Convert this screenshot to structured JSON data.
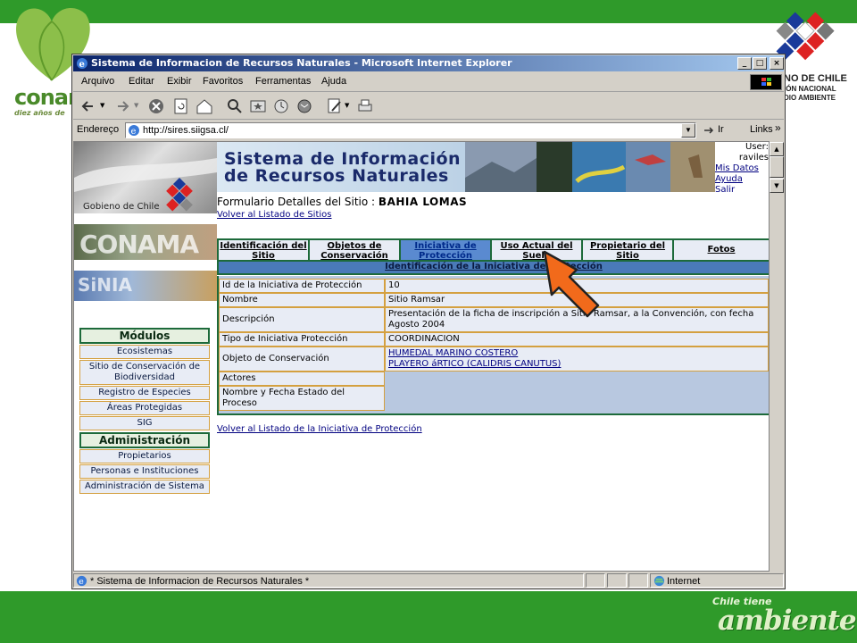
{
  "slide": {
    "logo_left": {
      "word": "conam",
      "sub": "diez años de"
    },
    "logo_right": {
      "line1": "NO DE CHILE",
      "line2": "IÓN NACIONAL",
      "line3": "DIO AMBIENTE"
    },
    "tagline": {
      "small": "Chile tiene",
      "big": "ambiente"
    },
    "colors": {
      "green": "#2f9a2a"
    }
  },
  "window": {
    "title": "Sistema de Informacion de Recursos Naturales - Microsoft Internet Explorer",
    "buttons": {
      "minimize": "_",
      "maximize": "□",
      "close": "×"
    },
    "menu": [
      "Arquivo",
      "Editar",
      "Exibir",
      "Favoritos",
      "Ferramentas",
      "Ajuda"
    ],
    "toolbar_icons": [
      "back-icon",
      "forward-icon",
      "stop-icon",
      "refresh-icon",
      "home-icon",
      "search-icon",
      "favorites-icon",
      "history-icon",
      "mail-icon",
      "print-icon"
    ],
    "address": {
      "label": "Endereço",
      "url": "http://sires.siigsa.cl/",
      "go": "Ir",
      "links": "Links"
    },
    "status": {
      "text": "Sistema de Informacion de Recursos Naturales",
      "zone": "Internet"
    }
  },
  "page": {
    "header": {
      "gob_label": "Gobieno de Chile",
      "title_line1": "Sistema de Información",
      "title_line2": "de Recursos Naturales",
      "user_label": "User:",
      "user_name": "raviles",
      "user_links": [
        "Mis Datos",
        "Ayuda",
        "Salir"
      ]
    },
    "banners": {
      "conama": "CONAMA",
      "sinia": "SiNIA"
    },
    "form_title_prefix": "Formulario Detalles del Sitio :",
    "form_title_site": "BAHIA LOMAS",
    "back_to_sites": "Volver al Listado de Sitios",
    "modules": {
      "title": "Módulos",
      "items": [
        "Ecosistemas",
        "Sitio de Conservación de Biodiversidad",
        "Registro de Especies",
        "Áreas Protegidas",
        "SIG"
      ]
    },
    "admin": {
      "title": "Administración",
      "items": [
        "Propietarios",
        "Personas e Instituciones",
        "Administración de Sistema"
      ]
    },
    "tabs": [
      {
        "label": "Identificación del Sitio",
        "active": false
      },
      {
        "label": "Objetos de Conservación",
        "active": false
      },
      {
        "label": "Iniciativa de Protección",
        "active": true
      },
      {
        "label": "Uso Actual del Suelo",
        "active": false
      },
      {
        "label": "Propietario del Sitio",
        "active": false
      },
      {
        "label": "Fotos",
        "active": false
      }
    ],
    "section_title": "Identificación de la Iniciativa de Protección",
    "details": [
      {
        "label": "Id de la Iniciativa de Protección",
        "value": "10"
      },
      {
        "label": "Nombre",
        "value": "Sitio Ramsar"
      },
      {
        "label": "Descripción",
        "value": "Presentación de la ficha de inscripción a Sitio Ramsar, a la Convención, con fecha Agosto 2004"
      },
      {
        "label": "Tipo de Iniciativa Protección",
        "value": "COORDINACION"
      },
      {
        "label": "Objeto de Conservación",
        "links": [
          "HUMEDAL MARINO COSTERO",
          "PLAYERO áRTICO (CALIDRIS CANUTUS)"
        ]
      },
      {
        "label": "Actores",
        "value": ""
      },
      {
        "label": "Nombre y Fecha Estado del Proceso",
        "value": ""
      }
    ],
    "back_to_initiatives": "Volver al Listado de la Iniciativa de Protección"
  }
}
